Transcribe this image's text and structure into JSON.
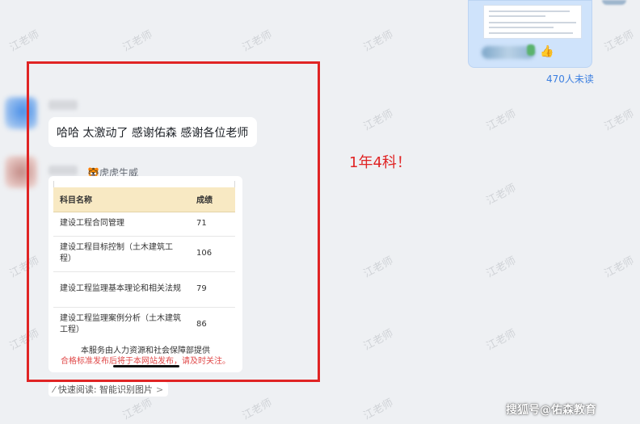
{
  "watermark_text": "江老师",
  "unread_label": "470人未读",
  "message": {
    "text": "哈哈 太激动了 感谢佑森 感谢各位老师"
  },
  "sender2": {
    "tag": "🐯虎虎生威"
  },
  "score_table": {
    "headers": [
      "科目名称",
      "成绩"
    ],
    "rows": [
      {
        "subject": "建设工程合同管理",
        "score": "71"
      },
      {
        "subject": "建设工程目标控制（土木建筑工程）",
        "score": "106"
      },
      {
        "subject": "建设工程监理基本理论和相关法规",
        "score": "79"
      },
      {
        "subject": "建设工程监理案例分析（土木建筑工程）",
        "score": "86"
      }
    ]
  },
  "image_footer": {
    "line1": "本服务由人力资源和社会保障部提供",
    "line2": "合格标准发布后将于本网站发布，请及时关注。"
  },
  "quick_read": {
    "label": "快速阅读: 智能识别图片",
    "chevron": ">"
  },
  "annotation": {
    "note": "1年4科！",
    "color": "#e02424"
  },
  "source_watermark": "搜狐号@佑森教育",
  "colors": {
    "background": "#eef0f3",
    "sent_bubble": "#cfe3fb",
    "link": "#3c7fe0",
    "table_header": "#f8e9c3"
  }
}
